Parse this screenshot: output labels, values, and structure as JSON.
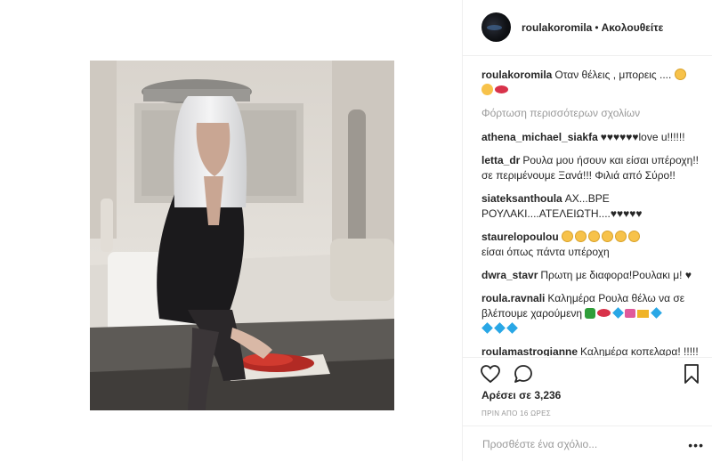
{
  "header": {
    "username": "roulakoromila",
    "separator": "•",
    "follow_label": "Ακολουθείτε"
  },
  "caption": {
    "username": "roulakoromila",
    "text": "Οταν θέλεις , μπορεις ...."
  },
  "load_more": "Φόρτωση περισσότερων σχολίων",
  "comments": [
    {
      "user": "athena_michael_siakfa",
      "text": "♥♥♥♥♥♥love u!!!!!!"
    },
    {
      "user": "letta_dr",
      "text": "Ρουλα μου ήσουν και είσαι υπέροχη!! σε περιμένουμε Ξανά!!! Φιλιά από Σύρο!!"
    },
    {
      "user": "siateksanthoula",
      "text": "ΑΧ...ΒΡΕ ΡΟΥΛΑΚΙ....ΑΤΕΛΕΙΩΤΗ....♥♥♥♥♥"
    },
    {
      "user": "staurelopoulou",
      "text": "είσαι όπως πάντα υπέροχη"
    },
    {
      "user": "dwra_stavr",
      "text": "Πρωτη με διαφορα!Ρουλακι μ! ♥"
    },
    {
      "user": "roula.ravnali",
      "text": "Καλημέρα Ρουλα θέλω να σε βλέπουμε χαρούμενη"
    },
    {
      "user": "roulamastrogianne",
      "text": "Καλημέρα κοπελαρα! !!!!!"
    }
  ],
  "likes": "Αρέσει σε 3,236",
  "timestamp": "ΠΡΙΝ ΑΠΟ 16 ΩΡΕΣ",
  "add_comment": {
    "placeholder": "Προσθέστε ένα σχόλιο..."
  },
  "more_label": "•••",
  "icons": {
    "like": "heart-outline-icon",
    "comment": "speech-bubble-icon",
    "save": "bookmark-icon"
  },
  "colors": {
    "text": "#262626",
    "muted": "#999999",
    "border": "#efefef"
  }
}
